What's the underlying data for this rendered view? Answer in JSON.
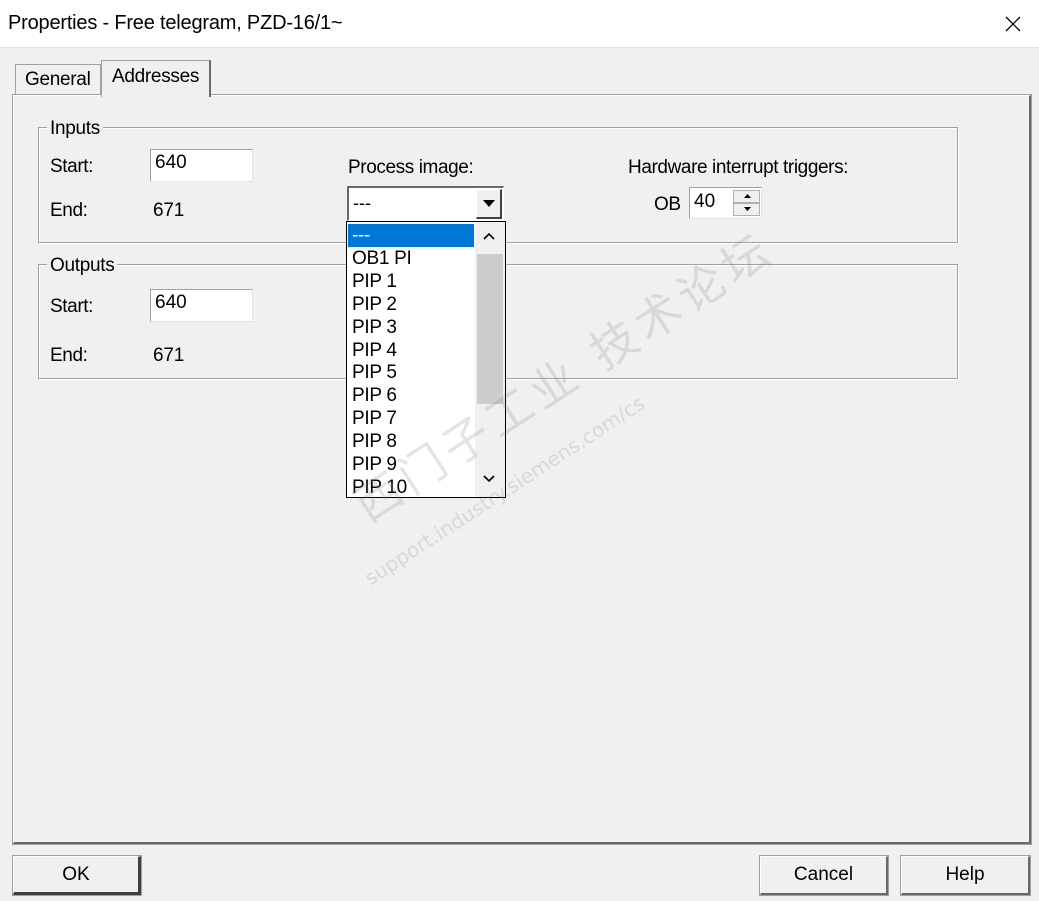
{
  "window": {
    "title": "Properties - Free telegram, PZD-16/1~"
  },
  "tabs": [
    {
      "label": "General",
      "active": false
    },
    {
      "label": "Addresses",
      "active": true
    }
  ],
  "inputs": {
    "group_label": "Inputs",
    "start_label": "Start:",
    "start_value": "640",
    "end_label": "End:",
    "end_value": "671",
    "process_image_label": "Process image:",
    "process_image_value": "---",
    "hw_interrupt_label": "Hardware interrupt triggers:",
    "ob_label": "OB",
    "ob_value": "40"
  },
  "outputs": {
    "group_label": "Outputs",
    "start_label": "Start:",
    "start_value": "640",
    "end_label": "End:",
    "end_value": "671"
  },
  "process_image_options": [
    "---",
    "OB1 PI",
    "PIP 1",
    "PIP 2",
    "PIP 3",
    "PIP 4",
    "PIP 5",
    "PIP 6",
    "PIP 7",
    "PIP 8",
    "PIP 9",
    "PIP 10"
  ],
  "selected_option_index": 0,
  "buttons": {
    "ok": "OK",
    "cancel": "Cancel",
    "help": "Help"
  },
  "watermark": {
    "line1": "西门子工业 技术论坛",
    "line2": "support.industry.siemens.com/cs"
  },
  "colors": {
    "selection": "#0078d7",
    "dialog_bg": "#f0f0f0"
  }
}
